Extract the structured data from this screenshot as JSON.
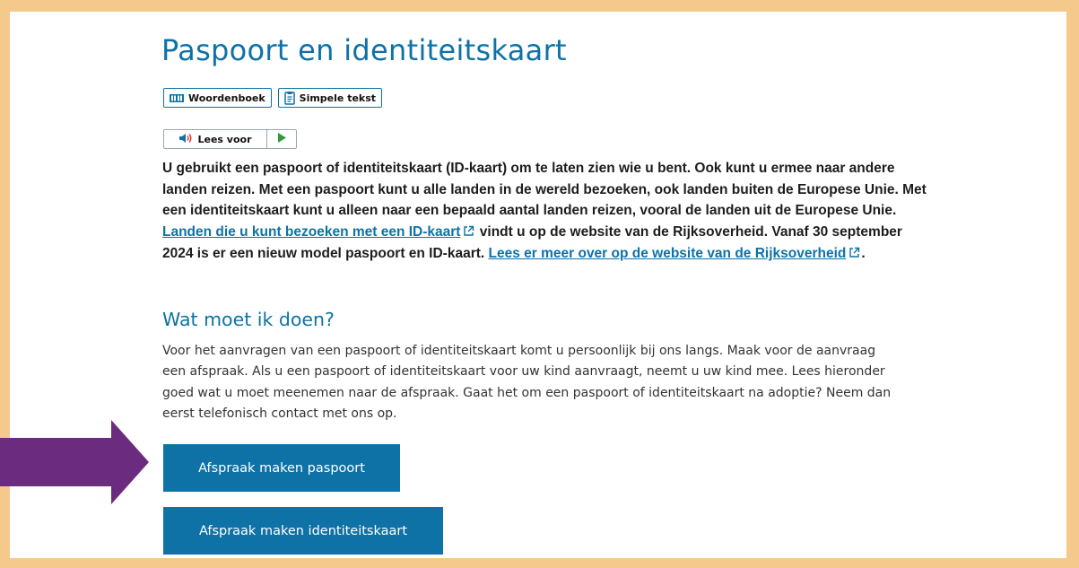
{
  "page": {
    "title": "Paspoort en identiteitskaart"
  },
  "toolbar": {
    "dictionary_label": "Woordenboek",
    "simple_text_label": "Simpele tekst",
    "read_aloud_label": "Lees voor"
  },
  "intro": {
    "part1": "U gebruikt een paspoort of identiteitskaart (ID-kaart) om te laten zien wie u bent. Ook kunt u ermee naar andere landen reizen. Met een paspoort kunt u alle landen in de wereld bezoeken, ook landen buiten de Europese Unie. Met een identiteitskaart kunt u alleen naar een bepaald aantal landen reizen, vooral de landen uit de Europese Unie. ",
    "link1": "Landen die u kunt bezoeken met een ID-kaart",
    "part2": " vindt u op de website van de Rijksoverheid. Vanaf 30 september 2024 is er een nieuw model paspoort en ID-kaart. ",
    "link2": "Lees er meer over op de website van de Rijksoverheid",
    "part3": "."
  },
  "section": {
    "title": "Wat moet ik doen?",
    "body": "Voor het aanvragen van een paspoort of identiteitskaart komt u persoonlijk bij ons langs. Maak voor de aanvraag een afspraak. Als u een paspoort of identiteitskaart voor uw kind aanvraagt, neemt u uw kind mee. Lees hieronder goed wat u moet meenemen naar de afspraak. Gaat het om een paspoort of identiteitskaart na adoptie? Neem dan eerst telefonisch contact met ons op."
  },
  "buttons": {
    "passport": "Afspraak maken paspoort",
    "id_card": "Afspraak maken identiteitskaart"
  },
  "colors": {
    "frame": "#f5c98c",
    "primary": "#0e72a6",
    "arrow": "#6b2c80",
    "play": "#2e9a3c"
  },
  "icons": {
    "dictionary": "book-icon",
    "simple_text": "document-icon",
    "read_aloud": "speaker-icon",
    "play": "play-icon",
    "external_link": "external-link-icon",
    "annotation": "arrow-annotation"
  }
}
